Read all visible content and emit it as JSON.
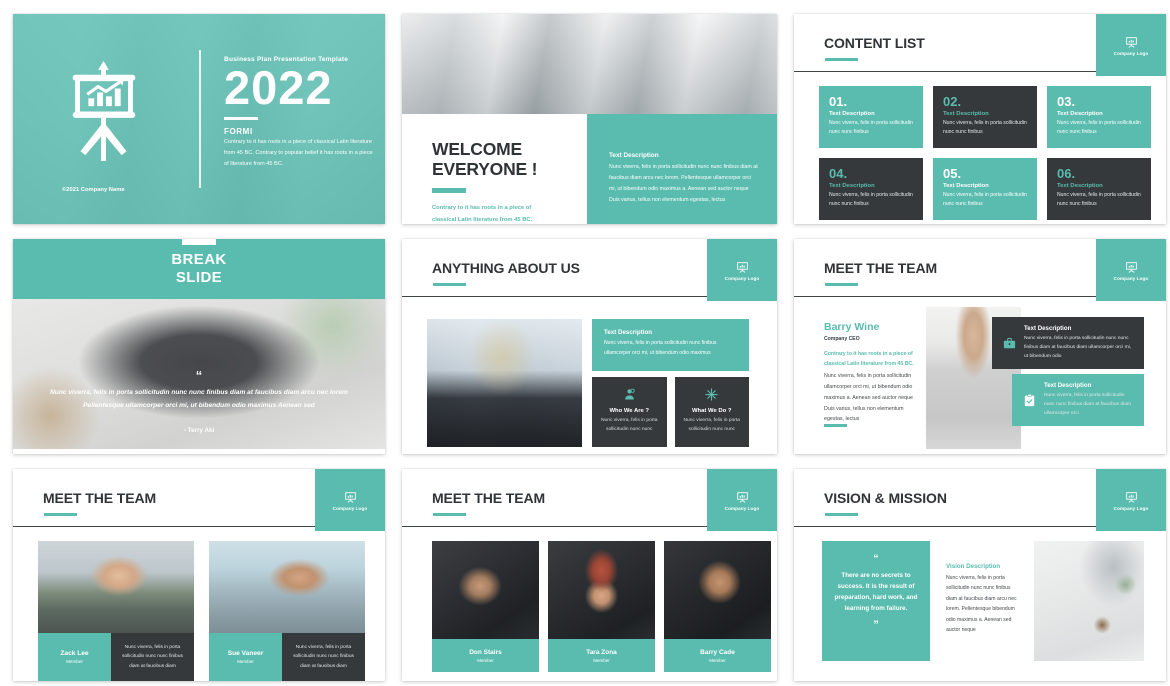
{
  "theme": {
    "teal": "#5ABCAF",
    "dark": "#35393c",
    "text_dark": "#2f3437",
    "white": "#ffffff"
  },
  "logo": {
    "label": "Company Logo",
    "icon": "presentation-board-icon"
  },
  "slides": {
    "cover": {
      "icon": "presentation-chart-icon",
      "subtitle": "Business Plan Presentation Template",
      "year": "2022",
      "brand": "FORMI",
      "body": "Contrary to it has roots in a piece of classical Latin literature from 45 BC. Contrary to popular belief it has roots in a piece of literature from 45 BC.",
      "copyright": "©2021 Company Name"
    },
    "welcome": {
      "title_line1": "WELCOME",
      "title_line2": "EVERYONE !",
      "lead": "Contrary to it has roots in a piece of classical Latin literature from 45 BC.",
      "box_heading": "Text Description",
      "box_body": "Nunc viverra, felis in porta sollicitudin nunc nunc finibus diam at faucibus diam arcu nec lorem. Pellentesque ullamcorper orci mi, ut bibendum odio maximus a. Aenean sed auctor neque Duis varius, tellus non elementum egestas, lectus"
    },
    "content_list": {
      "title": "CONTENT LIST",
      "cards": [
        {
          "number": "01.",
          "heading": "Text Description",
          "desc": "Nunc viverra, felis in porta sollicitudin nunc nunc finibus",
          "style": "teal"
        },
        {
          "number": "02.",
          "heading": "Text Description",
          "desc": "Nunc viverra, felis in porta sollicitudin nunc nunc finibus",
          "style": "dark"
        },
        {
          "number": "03.",
          "heading": "Text Description",
          "desc": "Nunc viverra, felis in porta sollicitudin nunc nunc finibus",
          "style": "teal"
        },
        {
          "number": "04.",
          "heading": "Text Description",
          "desc": "Nunc viverra, felis in porta sollicitudin nunc nunc finibus",
          "style": "dark"
        },
        {
          "number": "05.",
          "heading": "Text Description",
          "desc": "Nunc viverra, felis in porta sollicitudin nunc nunc finibus",
          "style": "teal"
        },
        {
          "number": "06.",
          "heading": "Text Description",
          "desc": "Nunc viverra, felis in porta sollicitudin nunc nunc finibus",
          "style": "dark"
        }
      ]
    },
    "break": {
      "title_line1": "BREAK",
      "title_line2": "SLIDE",
      "quote_mark": "“",
      "quote": "Nunc viverra, felis in porta sollicitudin nunc nunc finibus diam at faucibus diam arcu nec lorem Pellentesque ullamcorper orci mi, ut bibendum odio maximus Aenean sed",
      "author": "- Terry Aki"
    },
    "about": {
      "title": "ANYTHING ABOUT US",
      "box_heading": "Text Description",
      "box_body": "Nunc viverra, felis in porta sollicitudin nunc finibus ullamcorper orci mi, ut bibendum odio maximus",
      "cards": [
        {
          "icon": "person-badge-icon",
          "heading": "Who We Are ?",
          "desc": "Nunc viverra, felis in porta sollicitudin nunc nunc"
        },
        {
          "icon": "gear-burst-icon",
          "heading": "What We Do ?",
          "desc": "Nunc viverra, felis in porta sollicitudin nunc nunc"
        }
      ]
    },
    "team_ceo": {
      "title": "MEET THE TEAM",
      "name": "Barry Wine",
      "role": "Company CEO",
      "lead": "Contrary to it has roots in a piece of classical Latin literature from 45 BC.",
      "body": "Nunc viverra, felis in porta sollicitudin ullamcorper orci mi, ut bibendum odio maximus a. Aenean sed auctor neque Duis varius, tellus non elementum egestas, lectus",
      "box_dark": {
        "icon": "briefcase-icon",
        "heading": "Text Description",
        "desc": "Nunc viverra, felis in porta sollicitudin nunc nunc finibus diam at faucibus diam ullamcorper orci mi, ut bibendum odio"
      },
      "box_teal": {
        "icon": "clipboard-check-icon",
        "heading": "Text Description",
        "desc": "Nunc viverra, felis in porta sollicitudin nunc nunc finibus diam at faucibus diam ullamcorper orci"
      }
    },
    "team_two": {
      "title": "MEET THE TEAM",
      "members": [
        {
          "name": "Zack Lee",
          "role": "Member",
          "desc": "Nunc viverra, felis in porta sollicitudin nunc nunc finibus diam at faucibus diam"
        },
        {
          "name": "Sue Vaneer",
          "role": "Member",
          "desc": "Nunc viverra, felis in porta sollicitudin nunc nunc finibus diam at faucibus diam"
        }
      ]
    },
    "team_three": {
      "title": "MEET THE TEAM",
      "members": [
        {
          "name": "Don Stairs",
          "role": "Member"
        },
        {
          "name": "Tara Zona",
          "role": "Member"
        },
        {
          "name": "Barry Cade",
          "role": "Member"
        }
      ]
    },
    "vision": {
      "title": "VISION & MISSION",
      "quote_open": "“",
      "quote": "There are no secrets to success. It is the result of preparation, hard work, and learning from failure.",
      "quote_close": "”",
      "desc_heading": "Vision Description",
      "desc_body": "Nunc viverra, felis in porta sollicitudin nunc nunc finibus diam at faucibus diam arcu nec lorem. Pellentesque bibendum odio maximus a. Aenean sed auctor neque"
    }
  }
}
